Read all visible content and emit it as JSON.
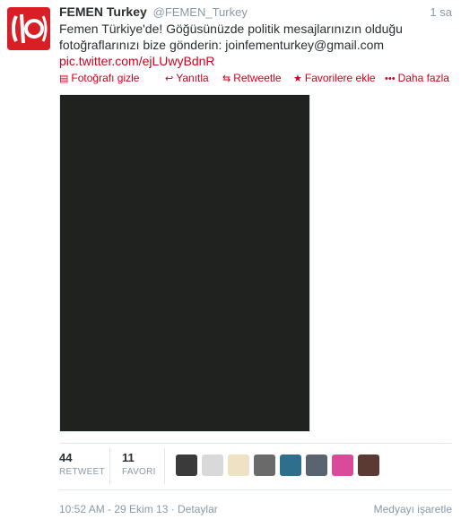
{
  "tweet": {
    "fullname": "FEMEN Turkey",
    "handle": "@FEMEN_Turkey",
    "time": "1 sa",
    "text": "Femen Türkiye'de! Göğüsünüzde politik mesajlarınızın olduğu fotoğraflarınızı bize gönderin: joinfementurkey@gmail.com",
    "link": "pic.twitter.com/ejLUwyBdnR"
  },
  "actions": [
    {
      "label": "Fotoğrafı gizle",
      "icon": "photo-icon"
    },
    {
      "label": "Yanıtla",
      "icon": "reply-icon"
    },
    {
      "label": "Retweetle",
      "icon": "retweet-icon"
    },
    {
      "label": "Favorilere ekle",
      "icon": "star-icon"
    },
    {
      "label": "Daha fazla",
      "icon": "more-icon"
    }
  ],
  "stats": {
    "retweets": "44",
    "retweets_label": "RETWEET",
    "favorites": "11",
    "favorites_label": "FAVORI"
  },
  "faces_colors": [
    "#3a3a3a",
    "#d9d9d9",
    "#efe2c4",
    "#6a6a6a",
    "#2e6f8e",
    "#5a6470",
    "#d94a9a",
    "#5a3a32"
  ],
  "footer": {
    "timestamp": "10:52 AM - 29 Ekim 13 · Detaylar",
    "flag": "Medyayı işaretle"
  },
  "colors": {
    "accent": "#d0011b",
    "brand": "#d91f26"
  }
}
